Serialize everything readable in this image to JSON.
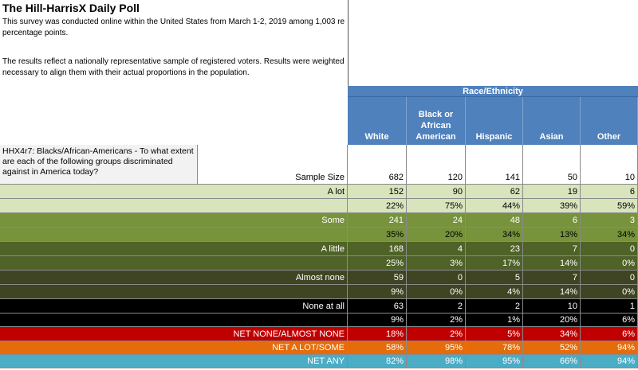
{
  "header": {
    "title": "The Hill-HarrisX Daily Poll",
    "note1_line1": "This survey was conducted online within the United States from March 1-2, 2019 among 1,003 re",
    "note1_line2": "percentage points.",
    "note2_line1": "The results reflect a nationally representative sample of registered voters. Results were weighted",
    "note2_line2": "necessary to align them with their actual proportions in the population."
  },
  "table": {
    "group_header": "Race/Ethnicity",
    "columns": [
      {
        "label": "White"
      },
      {
        "label": "Black or African American"
      },
      {
        "label": "Hispanic"
      },
      {
        "label": "Asian"
      },
      {
        "label": "Other"
      }
    ],
    "question": "HHX4r7: Blacks/African-Americans - To what extent are each of the following groups discriminated against in America today?",
    "sample_size": {
      "label": "Sample Size",
      "values": [
        "682",
        "120",
        "141",
        "50",
        "10"
      ]
    },
    "rows": [
      {
        "label": "A lot",
        "bg": "#d8e4bc",
        "fg": "#000000",
        "values": [
          "152",
          "90",
          "62",
          "19",
          "6"
        ]
      },
      {
        "label": "",
        "bg": "#d8e4bc",
        "fg": "#000000",
        "values": [
          "22%",
          "75%",
          "44%",
          "39%",
          "59%"
        ]
      },
      {
        "label": "Some",
        "bg": "#77933c",
        "fg": "#ffffff",
        "values": [
          "241",
          "24",
          "48",
          "6",
          "3"
        ]
      },
      {
        "label": "",
        "bg": "#77933c",
        "fg": "#000000",
        "values": [
          "35%",
          "20%",
          "34%",
          "13%",
          "34%"
        ]
      },
      {
        "label": "A little",
        "bg": "#4f6228",
        "fg": "#ffffff",
        "values": [
          "168",
          "4",
          "23",
          "7",
          "0"
        ]
      },
      {
        "label": "",
        "bg": "#4f6228",
        "fg": "#ffffff",
        "values": [
          "25%",
          "3%",
          "17%",
          "14%",
          "0%"
        ]
      },
      {
        "label": "Almost none",
        "bg": "#3f4422",
        "fg": "#ffffff",
        "values": [
          "59",
          "0",
          "5",
          "7",
          "0"
        ]
      },
      {
        "label": "",
        "bg": "#3f4422",
        "fg": "#ffffff",
        "values": [
          "9%",
          "0%",
          "4%",
          "14%",
          "0%"
        ]
      },
      {
        "label": "None at all",
        "bg": "#000000",
        "fg": "#ffffff",
        "values": [
          "63",
          "2",
          "2",
          "10",
          "1"
        ]
      },
      {
        "label": "",
        "bg": "#000000",
        "fg": "#ffffff",
        "values": [
          "9%",
          "2%",
          "1%",
          "20%",
          "6%"
        ]
      },
      {
        "label": "NET NONE/ALMOST NONE",
        "bg": "#c00000",
        "fg": "#ffffff",
        "values": [
          "18%",
          "2%",
          "5%",
          "34%",
          "6%"
        ]
      },
      {
        "label": "NET A LOT/SOME",
        "bg": "#e46c0a",
        "fg": "#ffffff",
        "values": [
          "58%",
          "95%",
          "78%",
          "52%",
          "94%"
        ]
      },
      {
        "label": "NET ANY",
        "bg": "#4bacc6",
        "fg": "#ffffff",
        "values": [
          "82%",
          "98%",
          "95%",
          "66%",
          "94%"
        ]
      }
    ]
  }
}
